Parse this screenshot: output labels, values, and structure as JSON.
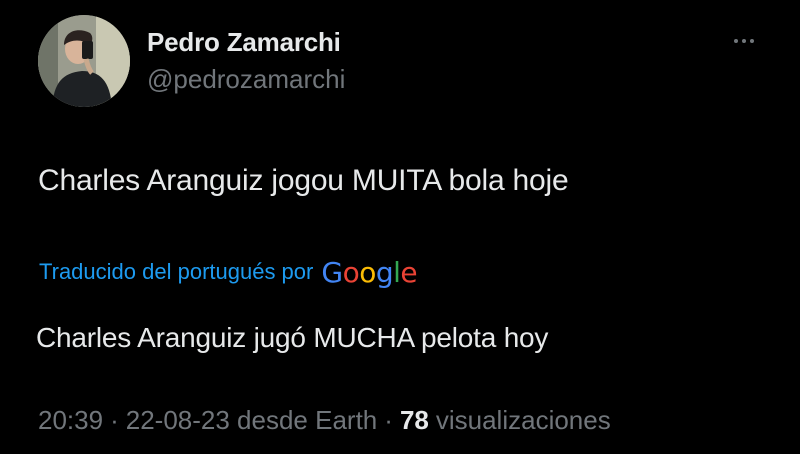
{
  "author": {
    "display_name": "Pedro Zamarchi",
    "handle": "@pedrozamarchi"
  },
  "tweet": {
    "text": "Charles Aranguiz jogou MUITA bola hoje",
    "translation_label": "Traducido del portugués por",
    "translation_brand": "Google",
    "translated_text": "Charles Aranguiz jugó MUCHA pelota hoy"
  },
  "meta": {
    "time": "20:39",
    "separator": "·",
    "date_source": "22-08-23 desde Earth",
    "views_count": "78",
    "views_label": "visualizaciones"
  },
  "icons": {
    "more": "more-horizontal-icon",
    "brand": "google-logo-icon"
  },
  "colors": {
    "background": "#000000",
    "text_primary": "#e7e9ea",
    "text_secondary": "#71767b",
    "link": "#1d9bf0",
    "google_blue": "#4285f4",
    "google_red": "#ea4335",
    "google_yellow": "#fbbc05",
    "google_green": "#34a853"
  }
}
